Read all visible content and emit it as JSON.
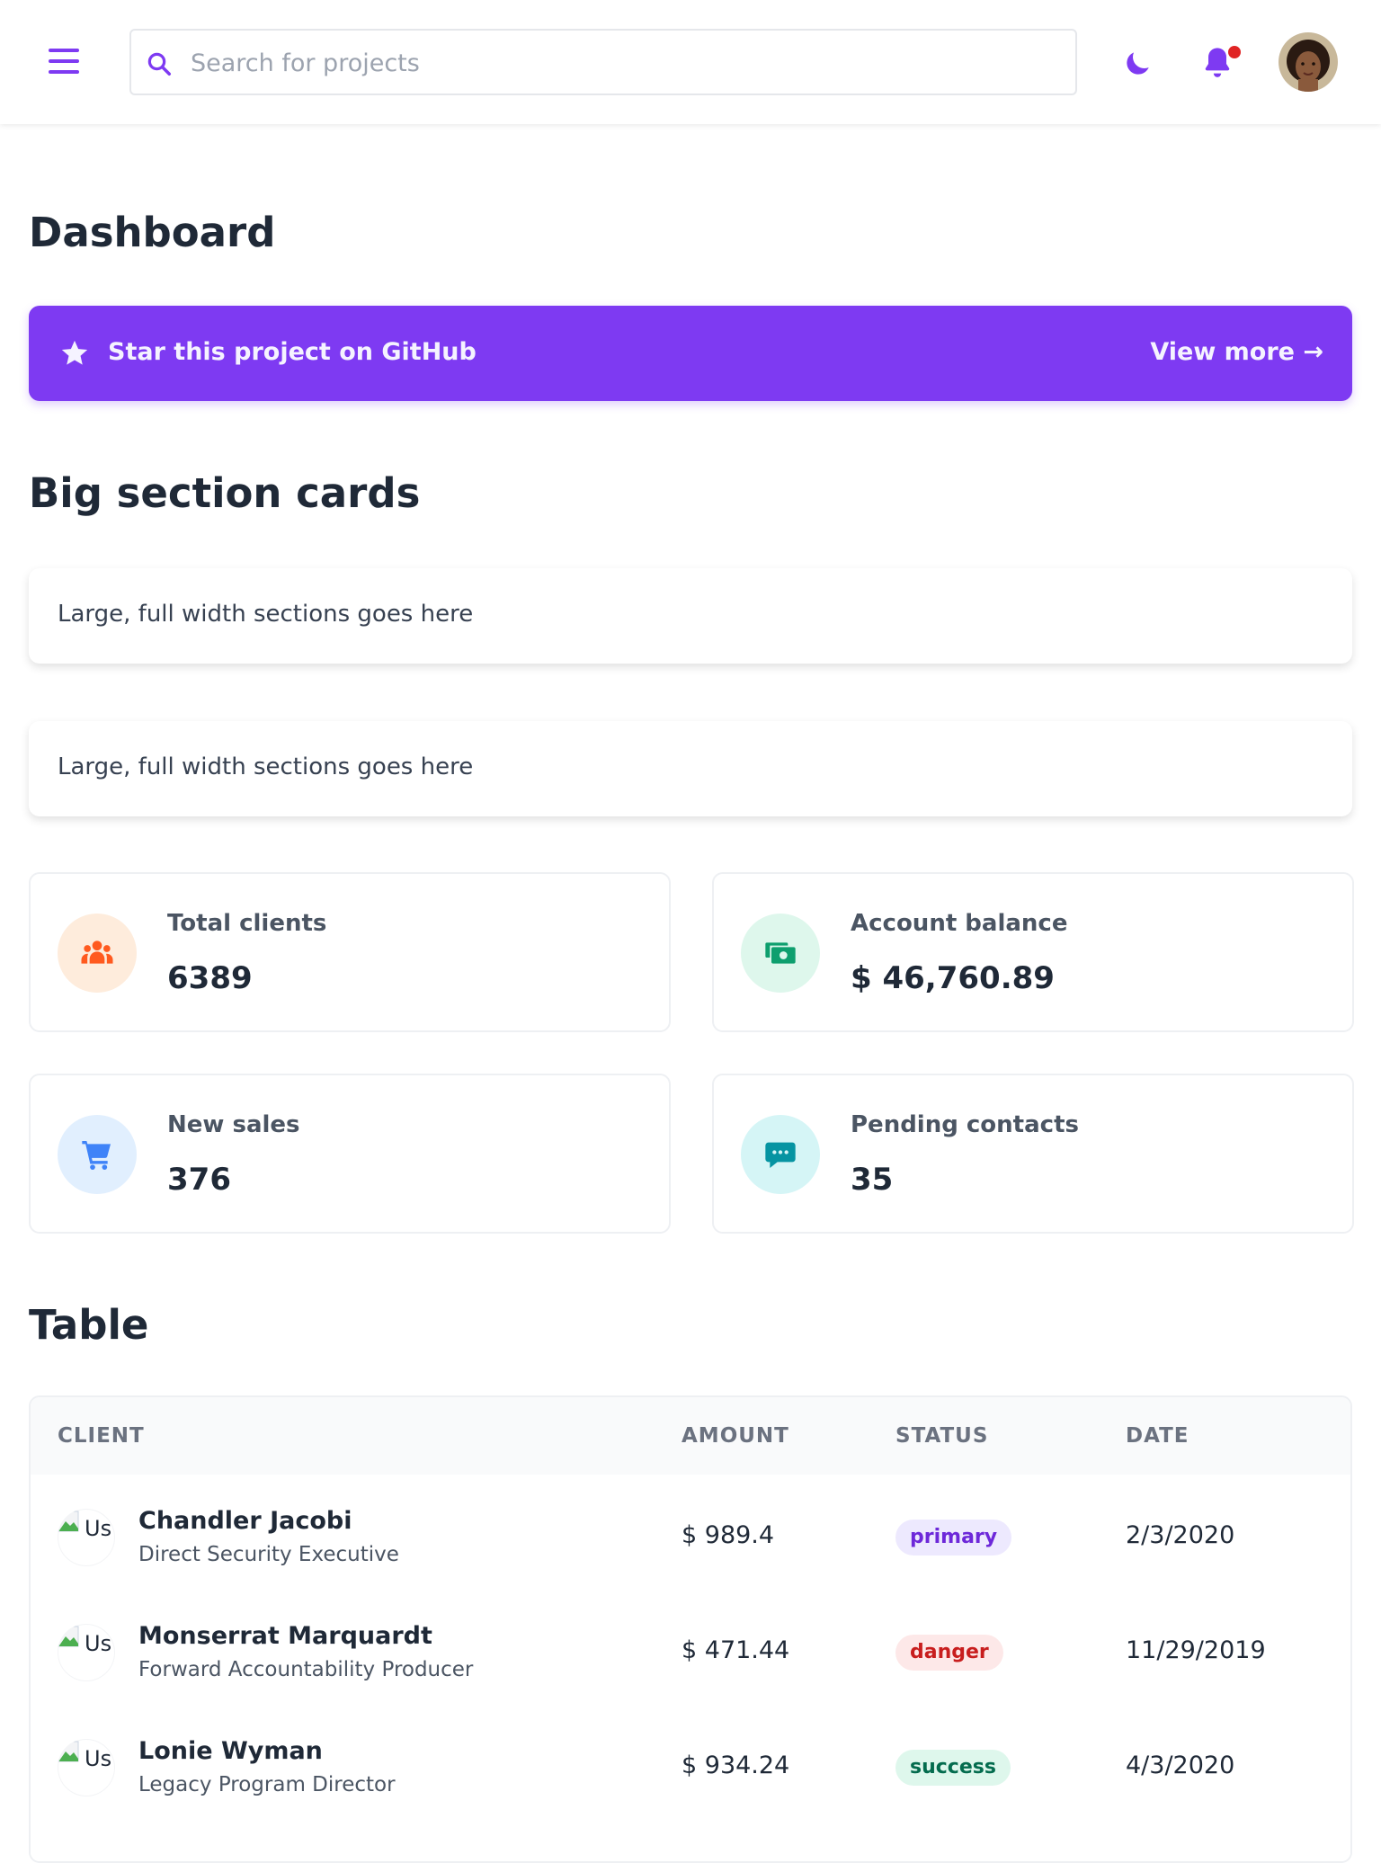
{
  "header": {
    "search_placeholder": "Search for projects",
    "icons": [
      "menu-icon",
      "search-icon",
      "moon-icon",
      "bell-icon",
      "avatar"
    ]
  },
  "page": {
    "title": "Dashboard"
  },
  "banner": {
    "text": "Star this project on GitHub",
    "link": "View more →",
    "color": "#7e3af2"
  },
  "big_cards": {
    "heading": "Big section cards",
    "cards": [
      {
        "text": "Large, full width sections goes here"
      },
      {
        "text": "Large, full width sections goes here"
      }
    ]
  },
  "stats": [
    {
      "label": "Total clients",
      "value": "6389",
      "icon": "people-icon",
      "accent": "#ff5a1f",
      "bg": "#feecdc"
    },
    {
      "label": "Account balance",
      "value": "$ 46,760.89",
      "icon": "cash-icon",
      "accent": "#0e9f6e",
      "bg": "#def7ec"
    },
    {
      "label": "New sales",
      "value": "376",
      "icon": "cart-icon",
      "accent": "#3f83f8",
      "bg": "#e1effe"
    },
    {
      "label": "Pending contacts",
      "value": "35",
      "icon": "chat-icon",
      "accent": "#0694a2",
      "bg": "#d5f5f6"
    }
  ],
  "table": {
    "heading": "Table",
    "columns": [
      "CLIENT",
      "AMOUNT",
      "STATUS",
      "DATE"
    ],
    "rows": [
      {
        "avatar_alt": "Us",
        "name": "Chandler Jacobi",
        "title": "Direct Security Executive",
        "amount": "$ 989.4",
        "status": "primary",
        "date": "2/3/2020"
      },
      {
        "avatar_alt": "Us",
        "name": "Monserrat Marquardt",
        "title": "Forward Accountability Producer",
        "amount": "$ 471.44",
        "status": "danger",
        "date": "11/29/2019"
      },
      {
        "avatar_alt": "Us",
        "name": "Lonie Wyman",
        "title": "Legacy Program Director",
        "amount": "$ 934.24",
        "status": "success",
        "date": "4/3/2020"
      }
    ]
  }
}
